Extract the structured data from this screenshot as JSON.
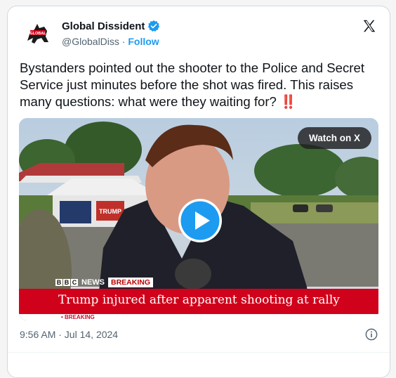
{
  "author": {
    "name": "Global Dissident",
    "handle": "@GlobalDiss",
    "separator": "·",
    "follow_label": "Follow"
  },
  "tweet": {
    "text": "Bystanders pointed out the shooter to the Police and Secret Service just minutes before the shot was fired. This raises questions: what were they waiting for?",
    "text_full": "Bystanders pointed out the shooter to the Police and Secret Service just minutes before the shot was fired. This raises many questions: what were they waiting for?",
    "emoji": "‼️"
  },
  "media": {
    "watch_label": "Watch on X",
    "bbc_letters": [
      "B",
      "B",
      "C"
    ],
    "news_label": "NEWS",
    "breaking_tag": "BREAKING",
    "headline": "Trump injured after apparent shooting at rally",
    "ticker": "• BREAKING",
    "scene_sign_text": "TRUMP"
  },
  "footer": {
    "timestamp": "9:56 AM · Jul 14, 2024"
  },
  "colors": {
    "accent": "#1d9bf0",
    "text": "#0f1419",
    "muted": "#536471",
    "bbc_red": "#d0021b"
  },
  "icons": [
    "avatar",
    "verified-badge-icon",
    "x-logo-icon",
    "play-icon",
    "info-icon"
  ]
}
